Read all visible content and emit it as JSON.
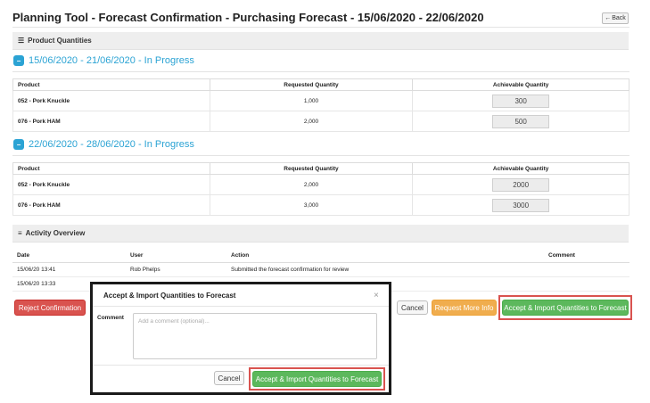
{
  "header": {
    "title": "Planning Tool - Forecast Confirmation - Purchasing Forecast - 15/06/2020 - 22/06/2020",
    "back_label": "Back",
    "back_icon": "arrow-left-icon"
  },
  "product_quantities": {
    "panel_label": "Product Quantities",
    "panel_icon": "list-icon",
    "columns": [
      "Product",
      "Requested Quantity",
      "Achievable Quantity"
    ],
    "periods": [
      {
        "label": "15/06/2020 - 21/06/2020 - In Progress",
        "rows": [
          {
            "product": "052 - Pork Knuckle",
            "requested": "1,000",
            "achievable": "300"
          },
          {
            "product": "076 - Pork HAM",
            "requested": "2,000",
            "achievable": "500"
          }
        ]
      },
      {
        "label": "22/06/2020 - 28/06/2020 - In Progress",
        "rows": [
          {
            "product": "052 - Pork Knuckle",
            "requested": "2,000",
            "achievable": "2000"
          },
          {
            "product": "076 - Pork HAM",
            "requested": "3,000",
            "achievable": "3000"
          }
        ]
      }
    ]
  },
  "activity": {
    "panel_label": "Activity Overview",
    "panel_icon": "rss-icon",
    "columns": [
      "Date",
      "User",
      "Action",
      "Comment"
    ],
    "rows": [
      {
        "date": "15/06/20 13:41",
        "user": "Rob Phelps",
        "action": "Submitted the forecast confirmation for review",
        "comment": ""
      },
      {
        "date": "15/06/20 13:33",
        "user": "",
        "action": "",
        "comment": ""
      }
    ]
  },
  "actions": {
    "reject_label": "Reject Confirmation",
    "cancel_label": "Cancel",
    "request_info_label": "Request More Info",
    "accept_label": "Accept & Import Quantities to Forecast"
  },
  "modal": {
    "title": "Accept & Import Quantities to Forecast",
    "comment_label": "Comment",
    "comment_placeholder": "Add a comment (optional)...",
    "cancel_label": "Cancel",
    "accept_label": "Accept & Import Quantities to Forecast"
  }
}
